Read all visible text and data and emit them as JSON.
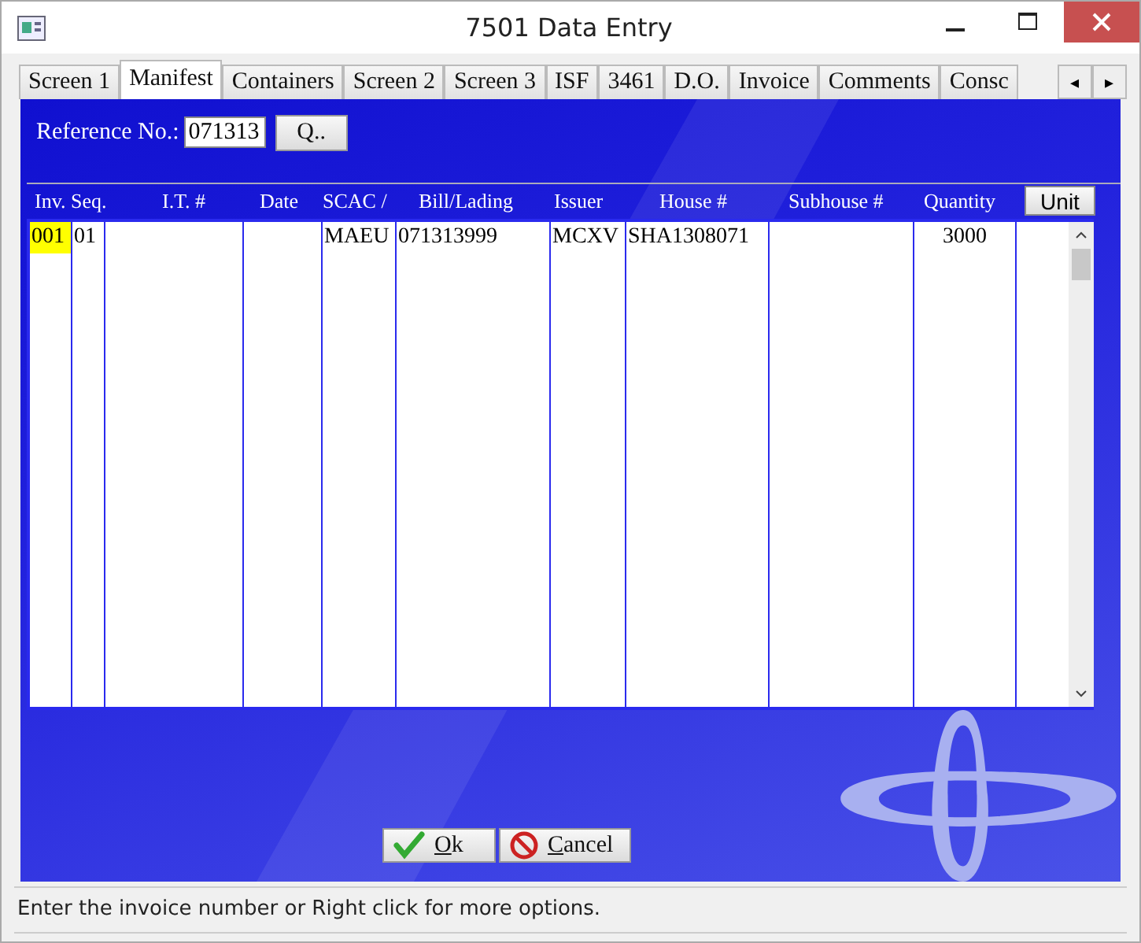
{
  "window": {
    "title": "7501 Data Entry"
  },
  "tabs": [
    {
      "label": "Screen 1",
      "selected": false
    },
    {
      "label": "Manifest",
      "selected": true
    },
    {
      "label": "Containers",
      "selected": false
    },
    {
      "label": "Screen 2",
      "selected": false
    },
    {
      "label": "Screen 3",
      "selected": false
    },
    {
      "label": "ISF",
      "selected": false
    },
    {
      "label": "3461",
      "selected": false
    },
    {
      "label": "D.O.",
      "selected": false
    },
    {
      "label": "Invoice",
      "selected": false
    },
    {
      "label": "Comments",
      "selected": false
    },
    {
      "label": "Consc",
      "selected": false
    }
  ],
  "tab_scroll": [
    "◂",
    "▸"
  ],
  "reference": {
    "label": "Reference No.:",
    "value": "071313",
    "query_button": "Q.."
  },
  "table": {
    "columns": [
      {
        "label": "Inv.",
        "kind": "text"
      },
      {
        "label": "Seq.",
        "kind": "text"
      },
      {
        "label": "I.T. #",
        "kind": "text"
      },
      {
        "label": "Date",
        "kind": "text"
      },
      {
        "label": "SCAC /",
        "kind": "text"
      },
      {
        "label": "Bill/Lading",
        "kind": "text"
      },
      {
        "label": "Issuer",
        "kind": "text"
      },
      {
        "label": "House #",
        "kind": "text"
      },
      {
        "label": "Subhouse #",
        "kind": "text"
      },
      {
        "label": "Quantity",
        "kind": "text"
      },
      {
        "label": "Unit",
        "kind": "button"
      }
    ],
    "rows": [
      {
        "inv": "001",
        "inv_selected": true,
        "seq": "01",
        "scac": "MAEU",
        "bill_lading": "071313999",
        "issuer": "MCXV",
        "house": "SHA1308071",
        "quantity": "3000"
      }
    ]
  },
  "buttons": [
    {
      "kind": "ok",
      "accel": "O",
      "rest": "k"
    },
    {
      "kind": "cancel",
      "accel": "C",
      "rest": "ancel"
    }
  ],
  "status_bar": "Enter the invoice number or Right click for more options."
}
